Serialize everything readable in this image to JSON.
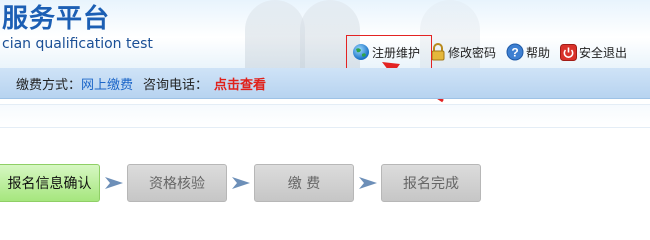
{
  "header": {
    "title": "服务平台",
    "subtitle": "cian qualification test"
  },
  "top_links": [
    {
      "label": "注册维护",
      "icon": "globe-icon"
    },
    {
      "label": "修改密码",
      "icon": "lock-icon"
    },
    {
      "label": "帮助",
      "icon": "help-icon"
    },
    {
      "label": "安全退出",
      "icon": "power-icon"
    }
  ],
  "info_bar": {
    "payment_label": "缴费方式：",
    "payment_value": "网上缴费",
    "phone_label": "咨询电话：",
    "phone_link": "点击查看"
  },
  "steps": [
    {
      "label": "报名信息确认",
      "state": "active"
    },
    {
      "label": "资格核验",
      "state": "inactive"
    },
    {
      "label": "缴 费",
      "state": "inactive"
    },
    {
      "label": "报名完成",
      "state": "inactive"
    }
  ],
  "colors": {
    "annotation": "#e32323",
    "link_blue": "#1c66c8",
    "link_red": "#e0211b",
    "active_step": "#a6e67e"
  }
}
